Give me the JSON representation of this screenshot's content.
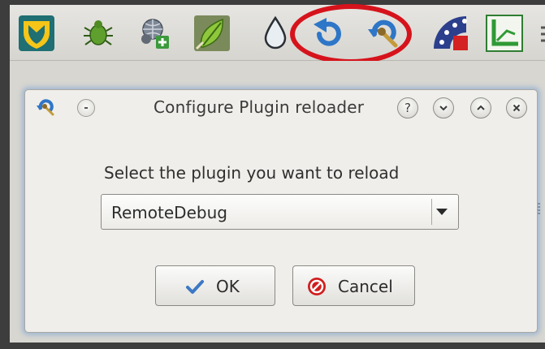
{
  "toolbar": {
    "icons": [
      "plugin-shield-icon",
      "bug-icon",
      "globe-settings-add-icon",
      "leaf-brush-icon",
      "water-drop-icon",
      "reload-arrow-icon",
      "plugin-reloader-config-icon",
      "color-wheel-icon",
      "green-chart-icon"
    ],
    "highlight_color": "#d6131c"
  },
  "dialog": {
    "title": "Configure Plugin reloader",
    "help_button": "?",
    "prompt": "Select the plugin you want to reload",
    "selected_plugin": "RemoteDebug",
    "ok_label": "OK",
    "cancel_label": "Cancel"
  },
  "colors": {
    "ok_check": "#3d78c4",
    "cancel_red": "#d11d1d",
    "glow": "#7aa0d2"
  }
}
